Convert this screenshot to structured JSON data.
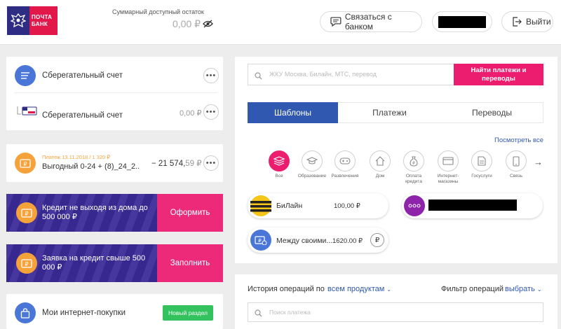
{
  "header": {
    "logo_line1": "ПОЧТА",
    "logo_line2": "БАНК",
    "balance_label": "Суммарный доступный остаток",
    "balance_value": "0,00 ₽",
    "contact_bank": "Связаться с банком",
    "logout": "Выйти"
  },
  "accounts": {
    "savings_title": "Сберегательный счет",
    "savings_sub_title": "Сберегательный счет",
    "savings_sub_amount": "0,00 ₽",
    "payment_note": "Платеж 13.11.2018 / 1 320 ₽",
    "loan_name": "Выгодный 0-24 + (8)_24_2...",
    "loan_amount_main": "− 21 574,",
    "loan_amount_cents": "59 ₽"
  },
  "promos": [
    {
      "text": "Кредит не выходя из дома до 500 000 ₽",
      "button": "Оформить"
    },
    {
      "text": "Заявка на кредит свыше 500 000 ₽",
      "button": "Заполнить"
    }
  ],
  "shopping": {
    "title": "Мои интернет-покупки",
    "badge": "Новый раздел"
  },
  "payments": {
    "search_placeholder": "ЖКУ Москва, Билайн, МТС, перевод",
    "search_button": "Найти платежи и переводы",
    "tabs": [
      "Шаблоны",
      "Платежи",
      "Переводы"
    ],
    "view_all": "Посмотреть все",
    "categories": [
      {
        "label": "Все",
        "icon": "stack-icon"
      },
      {
        "label": "Образование",
        "icon": "graduation-cap-icon"
      },
      {
        "label": "Развлечения",
        "icon": "gamepad-icon"
      },
      {
        "label": "Дом",
        "icon": "house-icon"
      },
      {
        "label": "Оплата кредита",
        "icon": "money-bag-icon"
      },
      {
        "label": "Интернет-магазины",
        "icon": "card-icon"
      },
      {
        "label": "Госуслуги",
        "icon": "document-icon"
      },
      {
        "label": "Связь",
        "icon": "phone-icon"
      }
    ],
    "templates": [
      {
        "name": "БиЛайн",
        "amount": "100,00 ₽"
      },
      {
        "name": "Между своими...",
        "amount": "1620.00 ₽"
      }
    ],
    "ruble_symbol": "₽"
  },
  "history": {
    "label": "История операций по",
    "link": "всем продуктам",
    "filter_label": "Фильтр операций",
    "filter_link": "выбрать",
    "search_placeholder": "Поиск платежа"
  },
  "colors": {
    "brand_blue": "#2e2d83",
    "brand_red": "#e2184a",
    "accent_pink": "#ec1d6f",
    "tab_blue": "#3158b0",
    "promo_purple": "#3a2a98",
    "orange_icon": "#f5a23a",
    "green_badge": "#33c25e"
  }
}
